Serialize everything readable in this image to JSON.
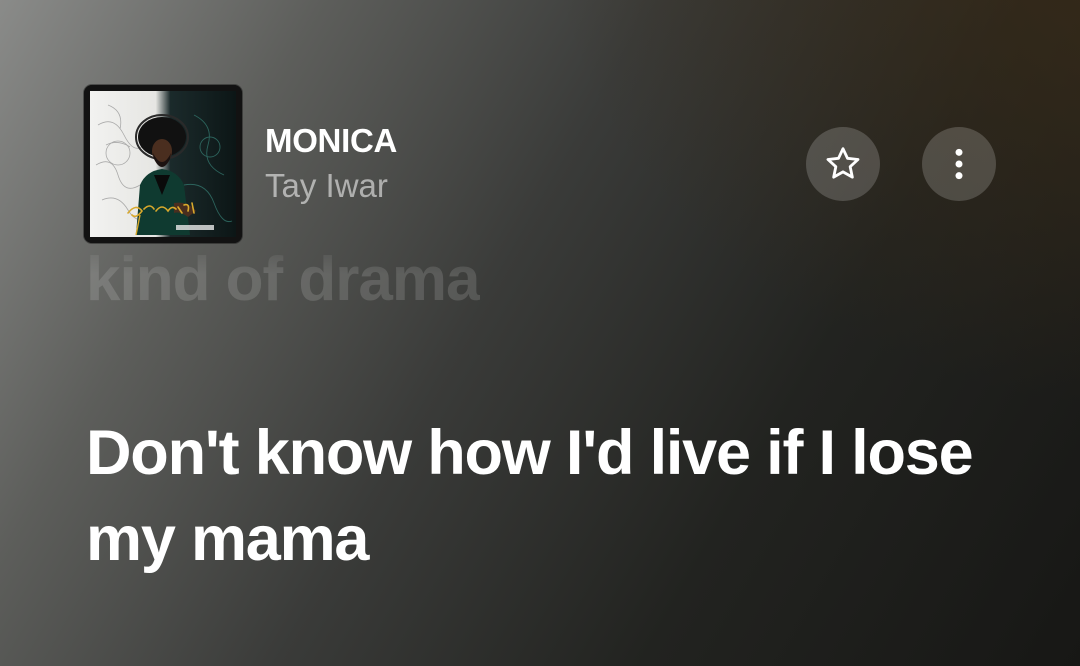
{
  "track": {
    "title": "MONICA",
    "artist": "Tay Iwar",
    "artwork_text": "Gemini"
  },
  "actions": {
    "favorite_icon": "star-outline-icon",
    "more_icon": "more-vertical-icon"
  },
  "lyrics": {
    "previous_line": "kind of drama",
    "current_line": "Don't know how I'd live if I lose my mama"
  },
  "colors": {
    "accent_text": "#ffffff",
    "secondary_text": "rgba(255,255,255,0.55)",
    "artwork_script": "#d9a92c"
  }
}
